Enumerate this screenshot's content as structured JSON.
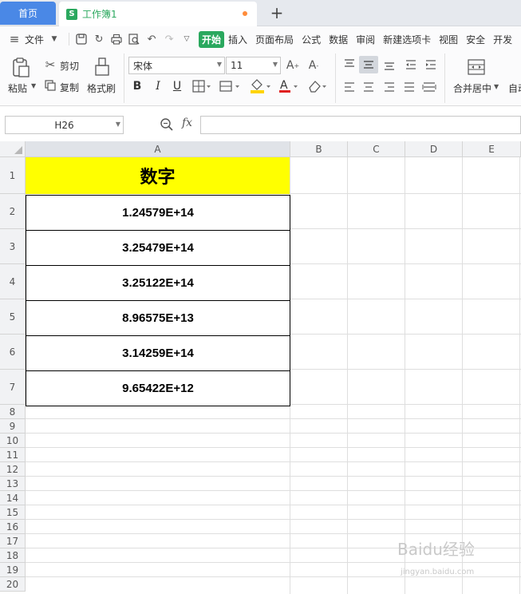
{
  "tabs": {
    "home": "首页",
    "doc_icon": "S",
    "doc": "工作簿1",
    "new_tab": "+"
  },
  "menu": {
    "file": "文件",
    "items": [
      "开始",
      "插入",
      "页面布局",
      "公式",
      "数据",
      "审阅",
      "新建选项卡",
      "视图",
      "安全",
      "开发"
    ]
  },
  "ribbon": {
    "paste": "粘贴",
    "cut": "剪切",
    "copy": "复制",
    "format_painter": "格式刷",
    "font_name": "宋体",
    "font_size": "11",
    "merge_center": "合并居中",
    "auto_wrap": "自动"
  },
  "formula_bar": {
    "cell_ref": "H26",
    "fx": "fx",
    "value": ""
  },
  "sheet": {
    "columns": [
      "A",
      "B",
      "C",
      "D",
      "E"
    ],
    "rows": [
      "1",
      "2",
      "3",
      "4",
      "5",
      "6",
      "7",
      "8",
      "9",
      "10",
      "11",
      "12",
      "13",
      "14",
      "15",
      "16",
      "17",
      "18",
      "19",
      "20"
    ],
    "header": "数字",
    "values": [
      "1.24579E+14",
      "3.25479E+14",
      "3.25122E+14",
      "8.96575E+13",
      "3.14259E+14",
      "9.65422E+12"
    ]
  },
  "watermark": {
    "main": "Baidu经验",
    "sub": "jingyan.baidu.com"
  },
  "colors": {
    "accent_green": "#2aa85e",
    "home_tab_blue": "#4a88e6",
    "header_fill": "#ffff00"
  }
}
